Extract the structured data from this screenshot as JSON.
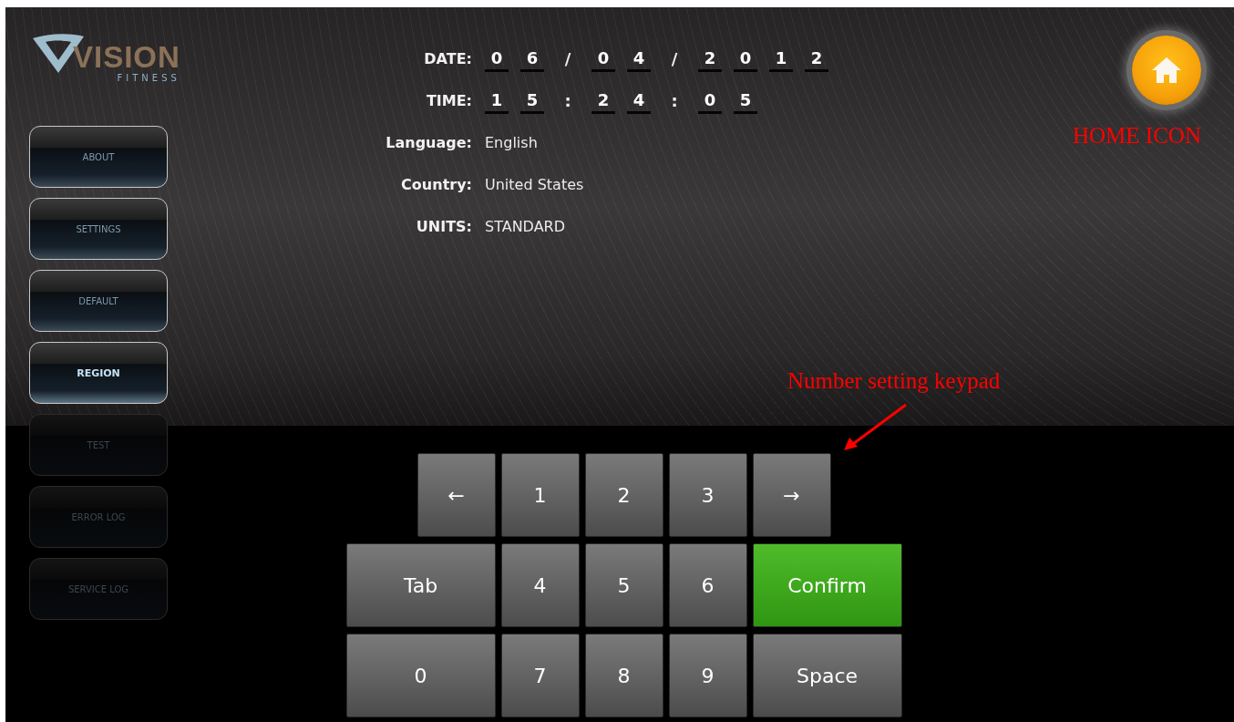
{
  "logo": {
    "brand": "VISION",
    "tagline": "FITNESS"
  },
  "sidebar": {
    "items": [
      {
        "label": "ABOUT",
        "selected": false,
        "disabled": false
      },
      {
        "label": "SETTINGS",
        "selected": false,
        "disabled": false
      },
      {
        "label": "DEFAULT",
        "selected": false,
        "disabled": false
      },
      {
        "label": "REGION",
        "selected": true,
        "disabled": false
      },
      {
        "label": "TEST",
        "selected": false,
        "disabled": true
      },
      {
        "label": "ERROR LOG",
        "selected": false,
        "disabled": true
      },
      {
        "label": "SERVICE LOG",
        "selected": false,
        "disabled": true
      }
    ]
  },
  "fields": [
    {
      "label": "DATE:",
      "kind": "digits",
      "parts": [
        {
          "kind": "digit",
          "text": "0"
        },
        {
          "kind": "digit",
          "text": "6"
        },
        {
          "kind": "separator",
          "text": "/"
        },
        {
          "kind": "digit",
          "text": "0"
        },
        {
          "kind": "digit",
          "text": "4"
        },
        {
          "kind": "separator",
          "text": "/"
        },
        {
          "kind": "digit",
          "text": "2"
        },
        {
          "kind": "digit",
          "text": "0"
        },
        {
          "kind": "digit",
          "text": "1"
        },
        {
          "kind": "digit",
          "text": "2"
        }
      ]
    },
    {
      "label": "TIME:",
      "kind": "digits",
      "parts": [
        {
          "kind": "digit",
          "text": "1"
        },
        {
          "kind": "digit",
          "text": "5"
        },
        {
          "kind": "separator",
          "text": ":"
        },
        {
          "kind": "digit",
          "text": "2"
        },
        {
          "kind": "digit",
          "text": "4"
        },
        {
          "kind": "separator",
          "text": ":"
        },
        {
          "kind": "digit",
          "text": "0"
        },
        {
          "kind": "digit",
          "text": "5"
        }
      ]
    },
    {
      "label": "Language:",
      "kind": "text",
      "value": "English"
    },
    {
      "label": "Country:",
      "kind": "text",
      "value": "United States"
    },
    {
      "label": "UNITS:",
      "kind": "text",
      "value": "STANDARD"
    }
  ],
  "keypad": {
    "rows": [
      [
        {
          "label": "←",
          "kind": "key"
        },
        {
          "label": "1",
          "kind": "key"
        },
        {
          "label": "2",
          "kind": "key"
        },
        {
          "label": "3",
          "kind": "key"
        },
        {
          "label": "→",
          "kind": "key"
        }
      ],
      [
        {
          "label": "Tab",
          "kind": "wide"
        },
        {
          "label": "4",
          "kind": "key"
        },
        {
          "label": "5",
          "kind": "key"
        },
        {
          "label": "6",
          "kind": "key"
        },
        {
          "label": "Confirm",
          "kind": "confirm"
        }
      ],
      [
        {
          "label": "0",
          "kind": "wide"
        },
        {
          "label": "7",
          "kind": "key"
        },
        {
          "label": "8",
          "kind": "key"
        },
        {
          "label": "9",
          "kind": "key"
        },
        {
          "label": "Space",
          "kind": "wide"
        }
      ]
    ]
  },
  "annotations": [
    {
      "text": "HOME ICON",
      "kind": "label"
    },
    {
      "text": "Number setting keypad",
      "kind": "arrow"
    }
  ]
}
